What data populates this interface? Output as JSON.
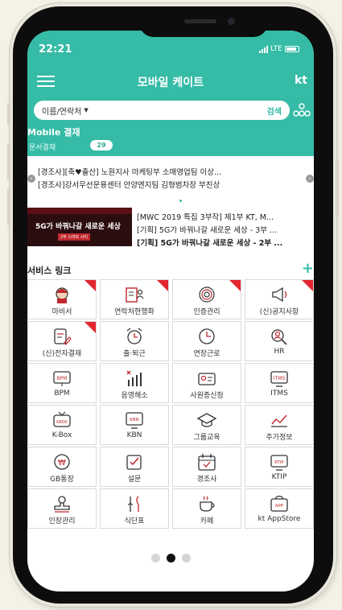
{
  "status": {
    "time": "22:21",
    "network": "LTE"
  },
  "header": {
    "title": "모바일 케이트",
    "brand": "kt"
  },
  "search": {
    "selector": "이름/연락처",
    "button": "검색"
  },
  "mobile_approval": {
    "title": "Mobile 결재",
    "sub": "문서결재",
    "count": "29"
  },
  "news": {
    "line1": "[경조사][축♥출산] 노원지사 마케팅부 소매영업팀 이상...",
    "line2": "[경조사]강서무선운용센터 안양엔지팀 김형범차장 부친상",
    "promo": [
      "[MWC 2019 특집 3부작] 제1부 KT, M...",
      "[기획] 5G가 바꿔나갈 새로운 세상 - 3부 ...",
      "[기획] 5G가 바꿔나갈 새로운 세상 - 2부 ..."
    ],
    "thumb_title": "5G가 바꿔나갈 새로운 세상",
    "thumb_tag": "2부 스마트 시티"
  },
  "services": {
    "title": "서비스 링크",
    "items": [
      {
        "label": "마비서",
        "icon": "assistant-icon",
        "flag": true
      },
      {
        "label": "연락처현행화",
        "icon": "contacts-icon",
        "flag": true
      },
      {
        "label": "인증관리",
        "icon": "fingerprint-icon",
        "flag": true
      },
      {
        "label": "(신)공지사항",
        "icon": "megaphone-icon",
        "flag": true
      },
      {
        "label": "(신)전자결재",
        "icon": "document-edit-icon",
        "flag": true
      },
      {
        "label": "출·퇴근",
        "icon": "alarm-clock-icon",
        "flag": false
      },
      {
        "label": "연장근로",
        "icon": "clock-icon",
        "flag": false
      },
      {
        "label": "HR",
        "icon": "hr-search-icon",
        "flag": false
      },
      {
        "label": "BPM",
        "icon": "bpm-icon",
        "flag": false
      },
      {
        "label": "음영해소",
        "icon": "signal-bars-icon",
        "flag": false
      },
      {
        "label": "사원증신청",
        "icon": "id-card-icon",
        "flag": false
      },
      {
        "label": "ITMS",
        "icon": "itms-icon",
        "flag": false
      },
      {
        "label": "K-Box",
        "icon": "kbox-tv-icon",
        "flag": false
      },
      {
        "label": "KBN",
        "icon": "kbn-monitor-icon",
        "flag": false
      },
      {
        "label": "그룹교육",
        "icon": "graduation-cap-icon",
        "flag": false
      },
      {
        "label": "주가정보",
        "icon": "stock-chart-icon",
        "flag": false
      },
      {
        "label": "GB통장",
        "icon": "won-coin-icon",
        "flag": false
      },
      {
        "label": "설문",
        "icon": "survey-check-icon",
        "flag": false
      },
      {
        "label": "경조사",
        "icon": "calendar-icon",
        "flag": false
      },
      {
        "label": "KTIP",
        "icon": "ktip-icon",
        "flag": false
      },
      {
        "label": "인장관리",
        "icon": "stamp-icon",
        "flag": false
      },
      {
        "label": "식단표",
        "icon": "utensils-icon",
        "flag": false
      },
      {
        "label": "카페",
        "icon": "coffee-cup-icon",
        "flag": false
      },
      {
        "label": "kt AppStore",
        "icon": "app-store-icon",
        "flag": false
      }
    ]
  },
  "colors": {
    "accent": "#35bba6",
    "flag": "#e2252f"
  }
}
